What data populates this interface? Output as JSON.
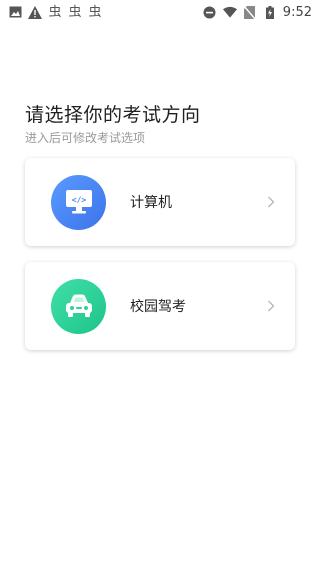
{
  "status_bar": {
    "time": "9:52",
    "left_icons": [
      "image-icon",
      "warning-icon",
      "app-icon",
      "app-icon",
      "app-icon"
    ],
    "right_icons": [
      "do-not-disturb-icon",
      "wifi-icon",
      "no-sim-icon",
      "battery-charging-icon"
    ]
  },
  "header": {
    "title": "请选择你的考试方向",
    "subtitle": "进入后可修改考试选项"
  },
  "options": [
    {
      "label": "计算机",
      "icon": "computer-code-icon",
      "color": "#4a86f5"
    },
    {
      "label": "校园驾考",
      "icon": "car-icon",
      "color": "#2fd39a"
    }
  ]
}
